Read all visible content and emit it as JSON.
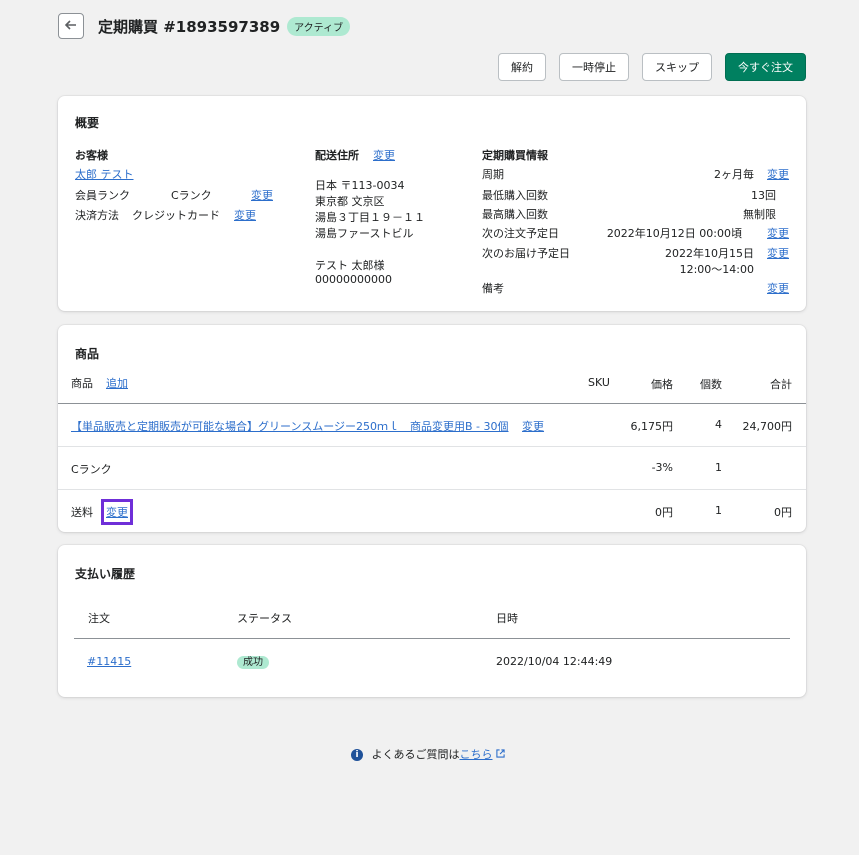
{
  "header": {
    "title": "定期購買 #1893597389",
    "status": "アクティブ"
  },
  "actions": {
    "cancel": "解約",
    "pause": "一時停止",
    "skip": "スキップ",
    "order_now": "今すぐ注文"
  },
  "overview": {
    "title": "概要",
    "customer": {
      "heading": "お客様",
      "name": "太郎 テスト",
      "rank_label": "会員ランク",
      "rank_value": "Cランク",
      "rank_change": "変更",
      "payment_label": "決済方法",
      "payment_value": "クレジットカード",
      "payment_change": "変更"
    },
    "shipping": {
      "heading": "配送住所",
      "change": "変更",
      "lines": [
        "日本 〒113-0034",
        "東京都 文京区",
        "湯島３丁目１９－１１",
        "湯島ファーストビル",
        "",
        "テスト 太郎様",
        "00000000000"
      ]
    },
    "subscription": {
      "heading": "定期購買情報",
      "rows": [
        {
          "label": "周期",
          "value": "2ヶ月毎",
          "change": "変更"
        },
        {
          "label": "最低購入回数",
          "value": "13回",
          "change": ""
        },
        {
          "label": "最高購入回数",
          "value": "無制限",
          "change": ""
        },
        {
          "label": "次の注文予定日",
          "value": "2022年10月12日 00:00頃",
          "change": "変更"
        },
        {
          "label": "次のお届け予定日",
          "value": "2022年10月15日",
          "value2": "12:00〜14:00",
          "change": "変更"
        },
        {
          "label": "備考",
          "value": "",
          "change": "変更"
        }
      ]
    }
  },
  "products": {
    "title": "商品",
    "header": {
      "product": "商品",
      "add": "追加",
      "sku": "SKU",
      "price": "価格",
      "qty": "個数",
      "total": "合計"
    },
    "rows": [
      {
        "name": "【単品販売と定期販売が可能な場合】グリーンスムージー250ｍｌ　商品変更用B - 30個",
        "change": "変更",
        "price": "6,175円",
        "qty": "4",
        "total": "24,700円"
      },
      {
        "name": "Cランク",
        "price": "-3%",
        "qty": "1",
        "total": ""
      },
      {
        "name": "送料",
        "change": "変更",
        "price": "0円",
        "qty": "1",
        "total": "0円"
      }
    ]
  },
  "payments": {
    "title": "支払い履歴",
    "header": {
      "order": "注文",
      "status": "ステータス",
      "date": "日時"
    },
    "rows": [
      {
        "order": "#11415",
        "status": "成功",
        "date": "2022/10/04 12:44:49"
      }
    ]
  },
  "footer": {
    "text": "よくあるご質問は",
    "link": "こちら"
  }
}
